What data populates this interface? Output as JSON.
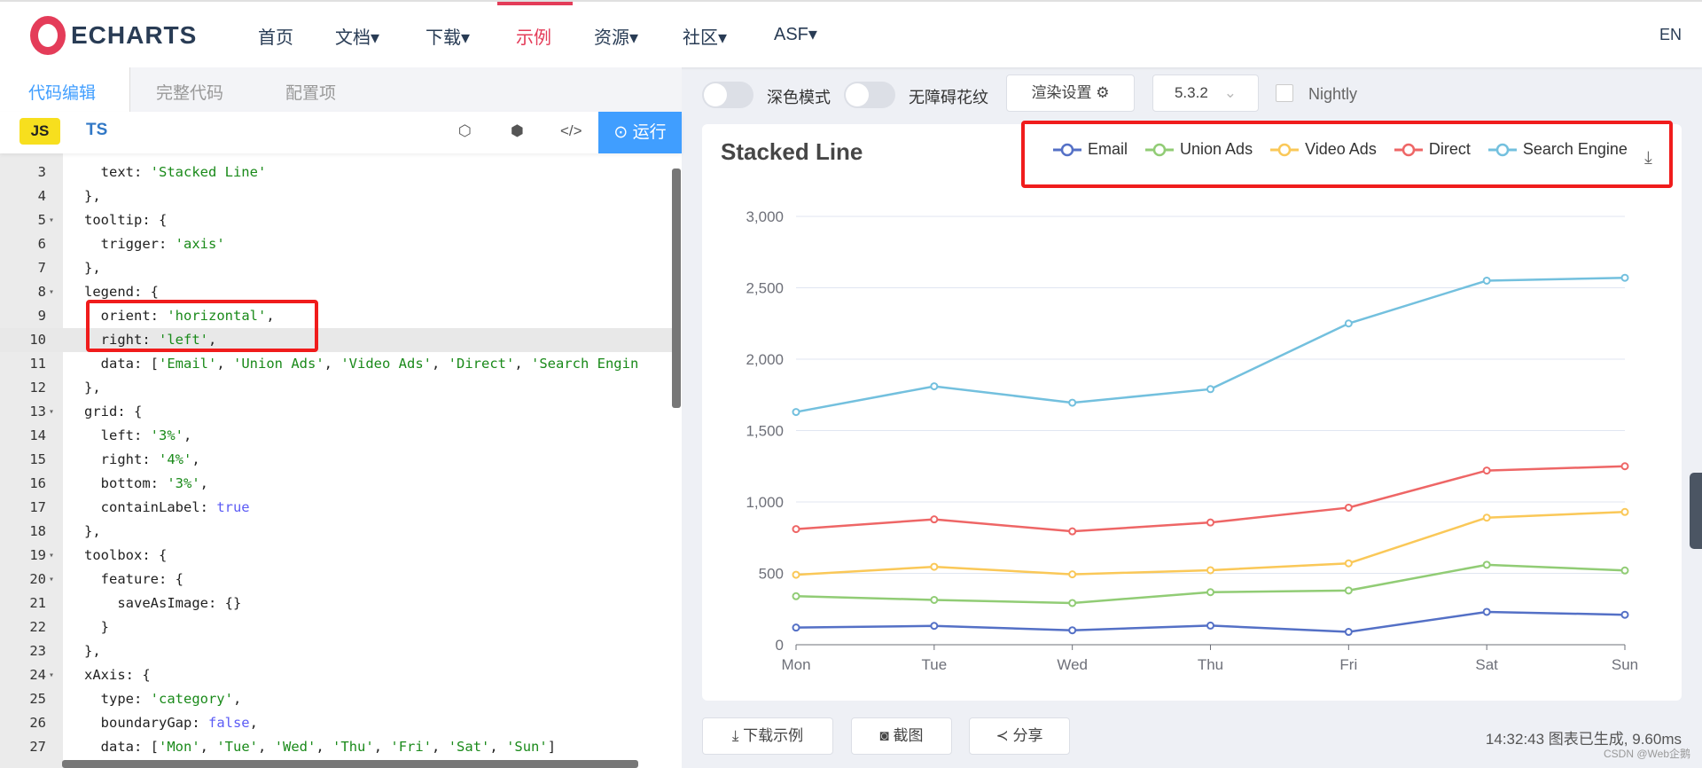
{
  "header": {
    "logo_text": "ECHARTS",
    "nav": [
      {
        "label": "首页"
      },
      {
        "label": "文档▾"
      },
      {
        "label": "下载▾"
      },
      {
        "label": "示例"
      },
      {
        "label": "资源▾"
      },
      {
        "label": "社区▾"
      },
      {
        "label": "ASF▾"
      }
    ],
    "active_index": 3,
    "lang": "EN"
  },
  "editor": {
    "tabs": [
      "代码编辑",
      "完整代码",
      "配置项"
    ],
    "js": "JS",
    "ts": "TS",
    "run": "运行",
    "lines": [
      {
        "n": "3",
        "f": "",
        "p": [
          [
            "  text: ",
            ""
          ],
          [
            "'Stacked Line'",
            "str"
          ]
        ]
      },
      {
        "n": "4",
        "f": "",
        "p": [
          [
            "},",
            ""
          ]
        ]
      },
      {
        "n": "5",
        "f": "▾",
        "p": [
          [
            "tooltip: {",
            ""
          ]
        ]
      },
      {
        "n": "6",
        "f": "",
        "p": [
          [
            "  trigger: ",
            ""
          ],
          [
            "'axis'",
            "str"
          ]
        ]
      },
      {
        "n": "7",
        "f": "",
        "p": [
          [
            "},",
            ""
          ]
        ]
      },
      {
        "n": "8",
        "f": "▾",
        "p": [
          [
            "legend: {",
            ""
          ]
        ]
      },
      {
        "n": "9",
        "f": "",
        "p": [
          [
            "  orient: ",
            ""
          ],
          [
            "'horizontal'",
            "str"
          ],
          [
            ",",
            ""
          ]
        ]
      },
      {
        "n": "10",
        "f": "",
        "p": [
          [
            "  right: ",
            ""
          ],
          [
            "'left'",
            "str"
          ],
          [
            ",",
            ""
          ]
        ]
      },
      {
        "n": "11",
        "f": "",
        "p": [
          [
            "  data: [",
            ""
          ],
          [
            "'Email'",
            "str"
          ],
          [
            ", ",
            ""
          ],
          [
            "'Union Ads'",
            "str"
          ],
          [
            ", ",
            ""
          ],
          [
            "'Video Ads'",
            "str"
          ],
          [
            ", ",
            ""
          ],
          [
            "'Direct'",
            "str"
          ],
          [
            ", ",
            ""
          ],
          [
            "'Search Engin",
            "str"
          ]
        ]
      },
      {
        "n": "12",
        "f": "",
        "p": [
          [
            "},",
            ""
          ]
        ]
      },
      {
        "n": "13",
        "f": "▾",
        "p": [
          [
            "grid: {",
            ""
          ]
        ]
      },
      {
        "n": "14",
        "f": "",
        "p": [
          [
            "  left: ",
            ""
          ],
          [
            "'3%'",
            "str"
          ],
          [
            ",",
            ""
          ]
        ]
      },
      {
        "n": "15",
        "f": "",
        "p": [
          [
            "  right: ",
            ""
          ],
          [
            "'4%'",
            "str"
          ],
          [
            ",",
            ""
          ]
        ]
      },
      {
        "n": "16",
        "f": "",
        "p": [
          [
            "  bottom: ",
            ""
          ],
          [
            "'3%'",
            "str"
          ],
          [
            ",",
            ""
          ]
        ]
      },
      {
        "n": "17",
        "f": "",
        "p": [
          [
            "  containLabel: ",
            ""
          ],
          [
            "true",
            "kw"
          ]
        ]
      },
      {
        "n": "18",
        "f": "",
        "p": [
          [
            "},",
            ""
          ]
        ]
      },
      {
        "n": "19",
        "f": "▾",
        "p": [
          [
            "toolbox: {",
            ""
          ]
        ]
      },
      {
        "n": "20",
        "f": "▾",
        "p": [
          [
            "  feature: {",
            ""
          ]
        ]
      },
      {
        "n": "21",
        "f": "",
        "p": [
          [
            "    saveAsImage: {}",
            ""
          ]
        ]
      },
      {
        "n": "22",
        "f": "",
        "p": [
          [
            "  }",
            ""
          ]
        ]
      },
      {
        "n": "23",
        "f": "",
        "p": [
          [
            "},",
            ""
          ]
        ]
      },
      {
        "n": "24",
        "f": "▾",
        "p": [
          [
            "xAxis: {",
            ""
          ]
        ]
      },
      {
        "n": "25",
        "f": "",
        "p": [
          [
            "  type: ",
            ""
          ],
          [
            "'category'",
            "str"
          ],
          [
            ",",
            ""
          ]
        ]
      },
      {
        "n": "26",
        "f": "",
        "p": [
          [
            "  boundaryGap: ",
            ""
          ],
          [
            "false",
            "kw"
          ],
          [
            ",",
            ""
          ]
        ]
      },
      {
        "n": "27",
        "f": "",
        "p": [
          [
            "  data: [",
            ""
          ],
          [
            "'Mon'",
            "str"
          ],
          [
            ", ",
            ""
          ],
          [
            "'Tue'",
            "str"
          ],
          [
            ", ",
            ""
          ],
          [
            "'Wed'",
            "str"
          ],
          [
            ", ",
            ""
          ],
          [
            "'Thu'",
            "str"
          ],
          [
            ", ",
            ""
          ],
          [
            "'Fri'",
            "str"
          ],
          [
            ", ",
            ""
          ],
          [
            "'Sat'",
            "str"
          ],
          [
            ", ",
            ""
          ],
          [
            "'Sun'",
            "str"
          ],
          [
            "]",
            ""
          ]
        ]
      }
    ],
    "highlight_line": "10"
  },
  "controls": {
    "dark_mode": "深色模式",
    "aria": "无障碍花纹",
    "render": "渲染设置 ⚙",
    "version": "5.3.2",
    "nightly": "Nightly"
  },
  "chart_data": {
    "type": "line",
    "stacked": true,
    "title": "Stacked Line",
    "categories": [
      "Mon",
      "Tue",
      "Wed",
      "Thu",
      "Fri",
      "Sat",
      "Sun"
    ],
    "series": [
      {
        "name": "Email",
        "color": "#5470c6",
        "values": [
          120,
          132,
          101,
          134,
          90,
          230,
          210
        ]
      },
      {
        "name": "Union Ads",
        "color": "#91cc75",
        "values": [
          220,
          182,
          191,
          234,
          290,
          330,
          310
        ]
      },
      {
        "name": "Video Ads",
        "color": "#fac858",
        "values": [
          150,
          232,
          201,
          154,
          190,
          330,
          410
        ]
      },
      {
        "name": "Direct",
        "color": "#ee6666",
        "values": [
          320,
          332,
          301,
          334,
          390,
          330,
          320
        ]
      },
      {
        "name": "Search Engine",
        "color": "#73c0de",
        "values": [
          820,
          932,
          901,
          934,
          1290,
          1330,
          1320
        ]
      }
    ],
    "ylim": [
      0,
      3000
    ],
    "yticks": [
      "0",
      "500",
      "1,000",
      "1,500",
      "2,000",
      "2,500",
      "3,000"
    ],
    "grid": true,
    "legend": "top-right"
  },
  "footer": {
    "download": "下载示例",
    "screenshot": "截图",
    "share": "分享",
    "status": "14:32:43   图表已生成, 9.60ms",
    "watermark": "CSDN @Web企鹅"
  }
}
